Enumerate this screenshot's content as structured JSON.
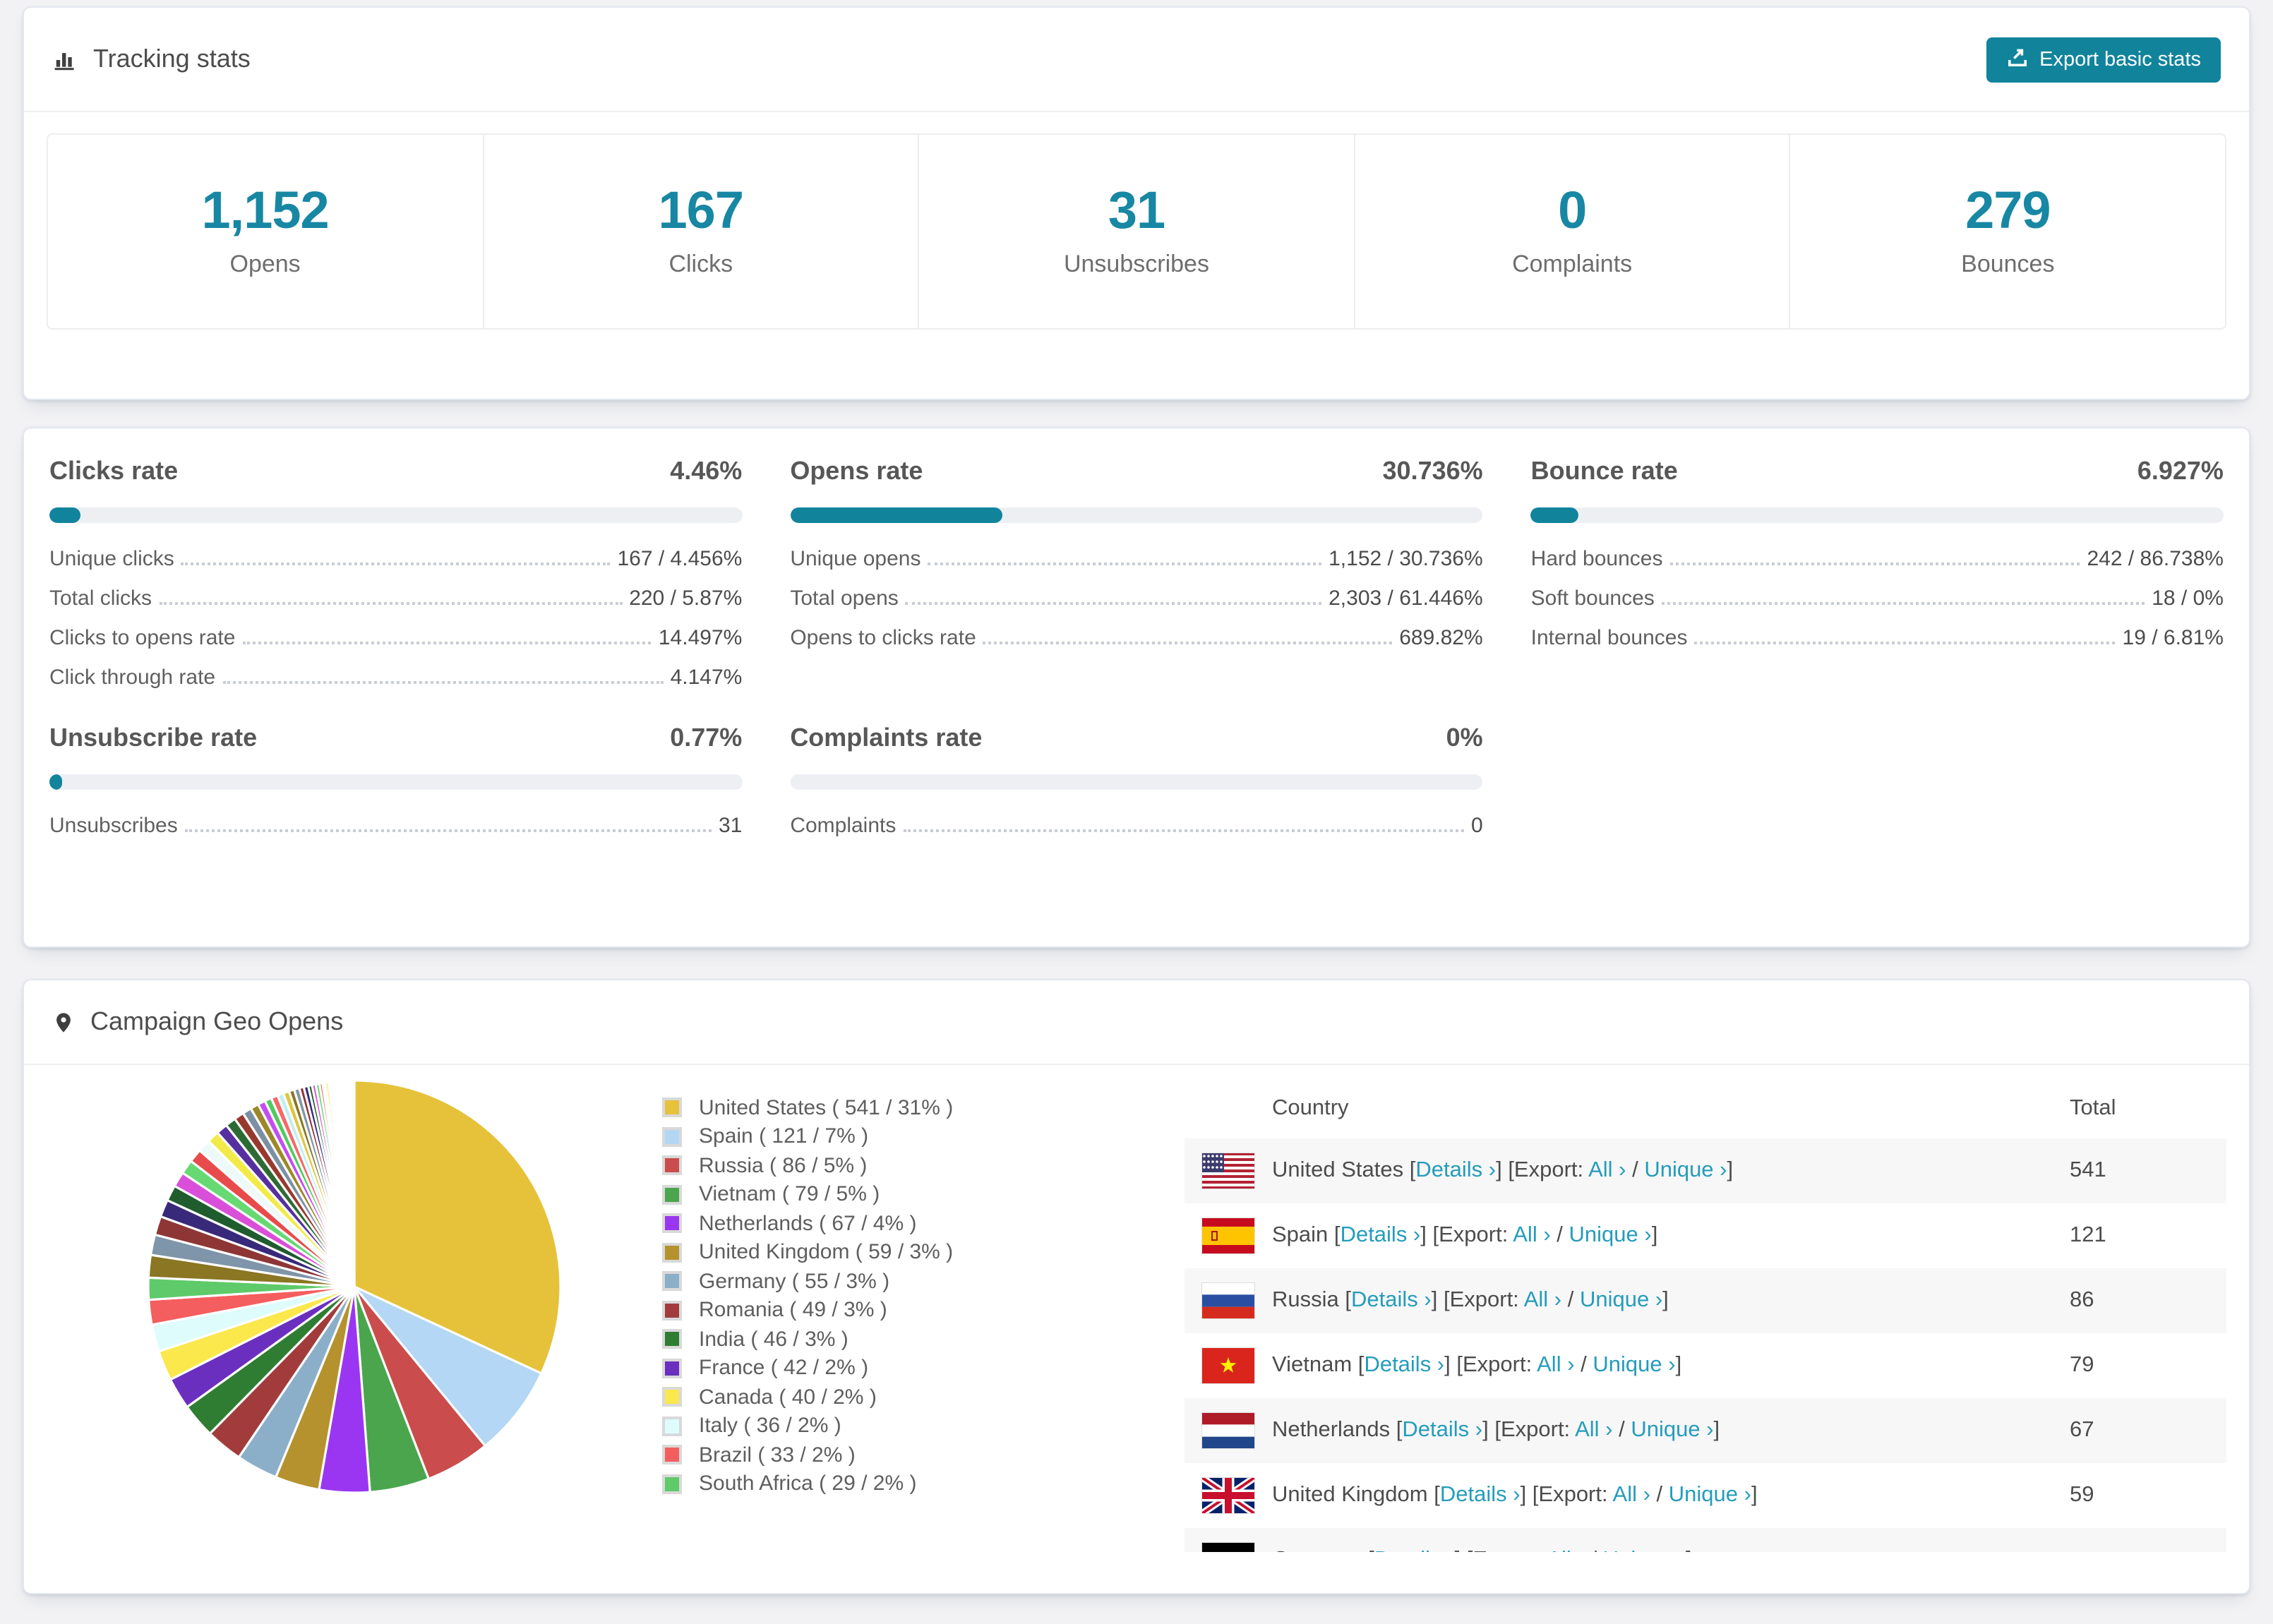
{
  "colors": {
    "accent": "#11849c",
    "stat_number": "#1787a3",
    "link": "#259cbb",
    "bar_track": "#edeff3",
    "row_stripe": "#f7f7f8",
    "page_bg": "#f2f2f4"
  },
  "tracking": {
    "title": "Tracking stats",
    "export_button": "Export basic stats",
    "stats": [
      {
        "value": "1,152",
        "label": "Opens"
      },
      {
        "value": "167",
        "label": "Clicks"
      },
      {
        "value": "31",
        "label": "Unsubscribes"
      },
      {
        "value": "0",
        "label": "Complaints"
      },
      {
        "value": "279",
        "label": "Bounces"
      }
    ]
  },
  "rates": {
    "blocks": [
      {
        "title": "Clicks rate",
        "value": "4.46%",
        "percent": 4.46,
        "rows": [
          [
            "Unique clicks",
            "167 / 4.456%"
          ],
          [
            "Total clicks",
            "220 / 5.87%"
          ],
          [
            "Clicks to opens rate",
            "14.497%"
          ],
          [
            "Click through rate",
            "4.147%"
          ]
        ]
      },
      {
        "title": "Opens rate",
        "value": "30.736%",
        "percent": 30.736,
        "rows": [
          [
            "Unique opens",
            "1,152 / 30.736%"
          ],
          [
            "Total opens",
            "2,303 / 61.446%"
          ],
          [
            "Opens to clicks rate",
            "689.82%"
          ]
        ]
      },
      {
        "title": "Bounce rate",
        "value": "6.927%",
        "percent": 6.927,
        "rows": [
          [
            "Hard bounces",
            "242 / 86.738%"
          ],
          [
            "Soft bounces",
            "18 / 0%"
          ],
          [
            "Internal bounces",
            "19 / 6.81%"
          ]
        ]
      },
      {
        "title": "Unsubscribe rate",
        "value": "0.77%",
        "percent": 0.77,
        "rows": [
          [
            "Unsubscribes",
            "31"
          ]
        ]
      },
      {
        "title": "Complaints rate",
        "value": "0%",
        "percent": 0,
        "rows": [
          [
            "Complaints",
            "0"
          ]
        ]
      }
    ]
  },
  "geo": {
    "title": "Campaign Geo Opens",
    "table": {
      "headers": [
        "Country",
        "Total"
      ],
      "links": {
        "details": "Details ›",
        "export": "Export:",
        "all": "All ›",
        "unique": "Unique ›"
      },
      "rows": [
        {
          "flag": "us",
          "country": "United States",
          "total": "541"
        },
        {
          "flag": "es",
          "country": "Spain",
          "total": "121"
        },
        {
          "flag": "ru",
          "country": "Russia",
          "total": "86"
        },
        {
          "flag": "vn",
          "country": "Vietnam",
          "total": "79"
        },
        {
          "flag": "nl",
          "country": "Netherlands",
          "total": "67"
        },
        {
          "flag": "gb",
          "country": "United Kingdom",
          "total": "59"
        },
        {
          "flag": "de",
          "country": "Germany",
          "partial": true
        }
      ]
    }
  },
  "chart_data": {
    "type": "pie",
    "title": "Campaign Geo Opens",
    "legend_position": "right",
    "start_angle_deg": -90,
    "direction": "clockwise",
    "slices": [
      {
        "label": "United States",
        "value": 541,
        "pct": 31,
        "color": "#e6c23b"
      },
      {
        "label": "Spain",
        "value": 121,
        "pct": 7,
        "color": "#b3d7f4"
      },
      {
        "label": "Russia",
        "value": 86,
        "pct": 5,
        "color": "#cb4c4c"
      },
      {
        "label": "Vietnam",
        "value": 79,
        "pct": 5,
        "color": "#4aa54d"
      },
      {
        "label": "Netherlands",
        "value": 67,
        "pct": 4,
        "color": "#9a36f1"
      },
      {
        "label": "United Kingdom",
        "value": 59,
        "pct": 3,
        "color": "#b5922e"
      },
      {
        "label": "Germany",
        "value": 55,
        "pct": 3,
        "color": "#8cafc9"
      },
      {
        "label": "Romania",
        "value": 49,
        "pct": 3,
        "color": "#a23c3c"
      },
      {
        "label": "India",
        "value": 46,
        "pct": 3,
        "color": "#2f7d32"
      },
      {
        "label": "France",
        "value": 42,
        "pct": 2,
        "color": "#6a2fbf"
      },
      {
        "label": "Canada",
        "value": 40,
        "pct": 2,
        "color": "#fae84c"
      },
      {
        "label": "Italy",
        "value": 36,
        "pct": 2,
        "color": "#dffcfc"
      },
      {
        "label": "Brazil",
        "value": 33,
        "pct": 2,
        "color": "#f45e5e"
      },
      {
        "label": "South Africa",
        "value": 29,
        "pct": 2,
        "color": "#5eca6a"
      }
    ],
    "others": {
      "note": "many unlabeled small-country slices",
      "values": [
        30,
        27,
        25,
        23,
        21,
        20,
        19,
        18,
        17,
        16,
        15,
        14,
        13,
        12,
        11,
        10,
        9,
        9,
        8,
        8,
        7,
        7,
        6,
        6,
        5,
        5,
        5,
        4,
        4,
        4,
        3,
        3,
        3,
        3,
        2,
        2,
        2,
        2,
        2,
        2,
        1,
        1,
        1,
        1,
        1,
        1,
        1,
        1,
        1,
        1
      ],
      "palette": [
        "#8a7623",
        "#7f95a9",
        "#8e3636",
        "#38297a",
        "#1f5c2e",
        "#d94fd9",
        "#66d973",
        "#e84b4b",
        "#eefafa",
        "#f2ea49",
        "#55309e",
        "#2e6b34",
        "#98392e",
        "#7c90a4",
        "#9c8829",
        "#c44df0",
        "#52c95e",
        "#f56868",
        "#c2eef0",
        "#dec63f"
      ]
    }
  }
}
